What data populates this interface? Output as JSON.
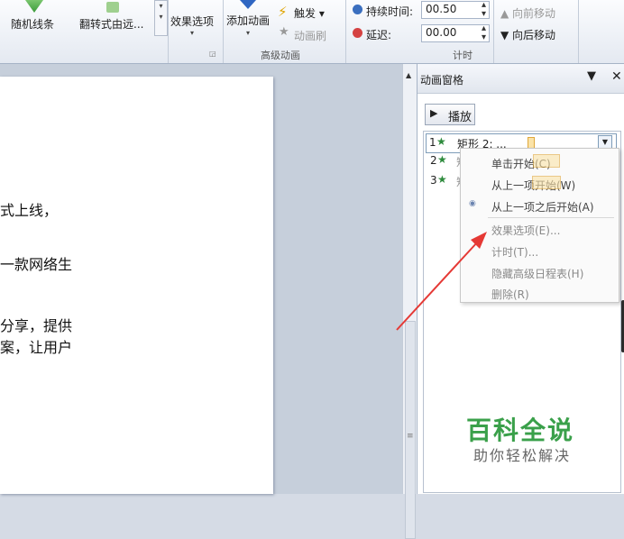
{
  "ribbon": {
    "effects": [
      "随机线条",
      "翻转式由远..."
    ],
    "effect_options": "效果选项",
    "add_animation": "添加动画",
    "trigger": "触发",
    "animation_painter": "动画刷",
    "advanced_group": "高级动画",
    "duration_label": "持续时间:",
    "duration_value": "00.50",
    "delay_label": "延迟:",
    "delay_value": "00.00",
    "move_earlier": "向前移动",
    "move_later": "向后移动",
    "timing_group": "计时"
  },
  "document": {
    "lines": [
      "式上线，",
      "一款网络生",
      "分享，提供",
      "案，让用户"
    ]
  },
  "pane": {
    "title": "动画窗格",
    "play_label": "播放",
    "items": [
      {
        "num": "1",
        "label": "矩形 2: ..."
      },
      {
        "num": "2",
        "label": "矩开"
      },
      {
        "num": "3",
        "label": "矩形"
      }
    ],
    "menu": [
      "单击开始(C)",
      "从上一项开始(W)",
      "从上一项之后开始(A)",
      "效果选项(E)...",
      "计时(T)...",
      "隐藏高级日程表(H)",
      "删除(R)"
    ]
  },
  "watermark": {
    "title": "百科全说",
    "subtitle": "助你轻松解决"
  },
  "colors": {
    "arrow": "#e53935",
    "watermark_green": "#3aa04a"
  }
}
